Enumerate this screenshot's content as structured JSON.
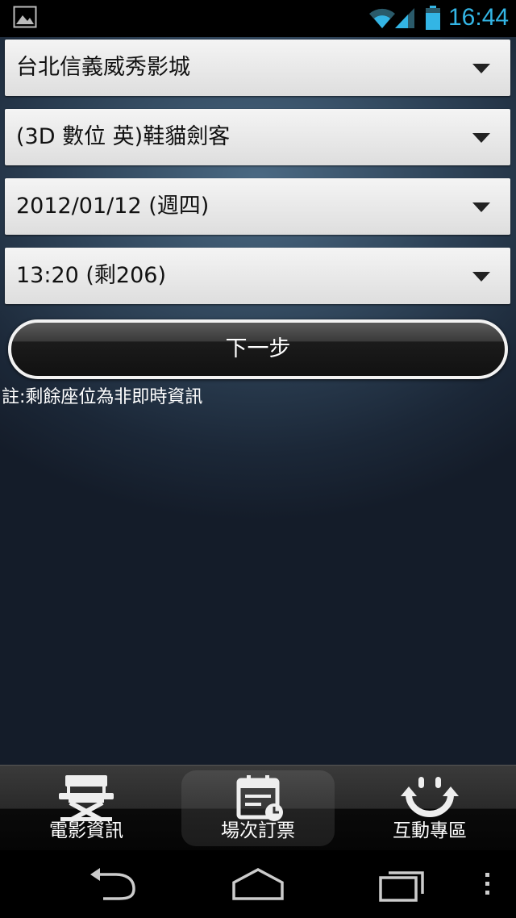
{
  "status_bar": {
    "time": "16:44",
    "accent_color": "#33b5e5",
    "icons": [
      "gallery-icon",
      "wifi-icon",
      "signal-icon",
      "battery-icon"
    ]
  },
  "form": {
    "theater": "台北信義威秀影城",
    "movie": "(3D 數位 英)鞋貓劍客",
    "date": "2012/01/12 (週四)",
    "showtime": "13:20 (剩206)",
    "next_label": "下一步",
    "note": "註:剩餘座位為非即時資訊"
  },
  "tabs": [
    {
      "label": "電影資訊",
      "icon": "director-chair-icon",
      "active": false
    },
    {
      "label": "場次訂票",
      "icon": "calendar-clock-icon",
      "active": true
    },
    {
      "label": "互動專區",
      "icon": "smiley-arrows-icon",
      "active": false
    }
  ],
  "nav": {
    "icons": [
      "back-icon",
      "home-icon",
      "recent-apps-icon",
      "overflow-menu-icon"
    ]
  }
}
